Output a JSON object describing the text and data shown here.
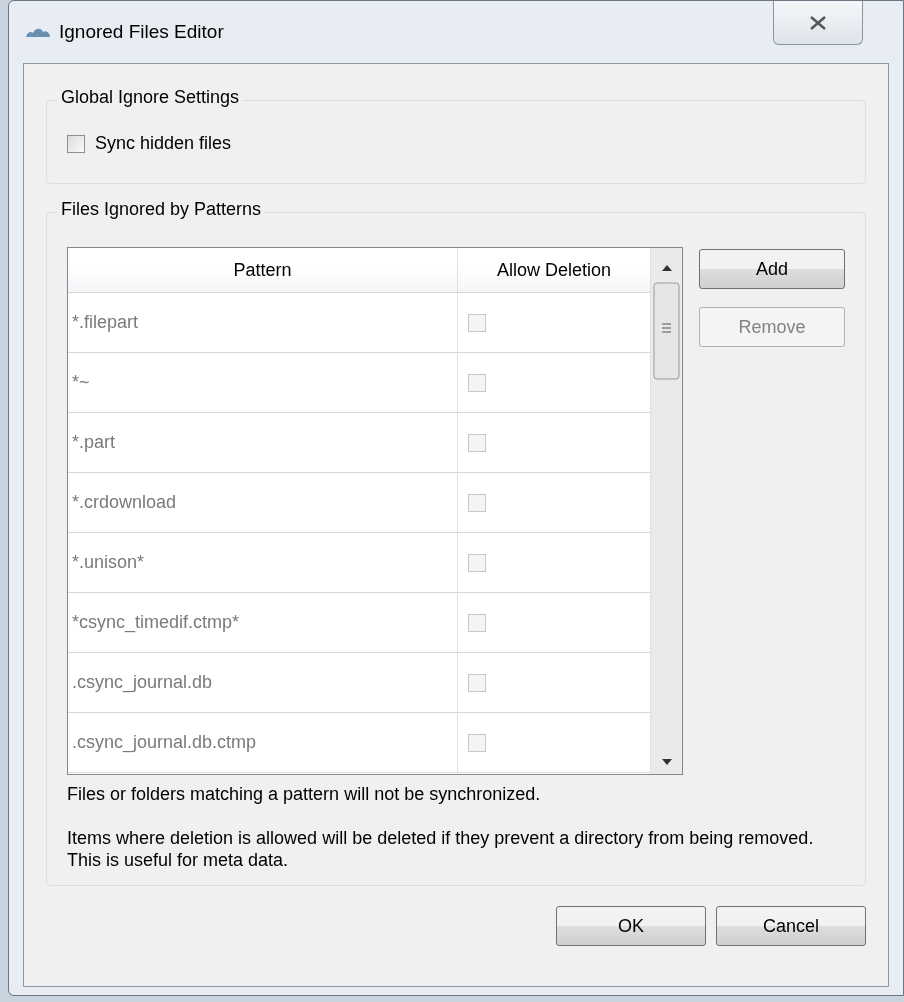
{
  "window": {
    "title": "Ignored Files Editor"
  },
  "global_group": {
    "title": "Global Ignore Settings",
    "checkbox": {
      "label": "Sync hidden files",
      "checked": false
    }
  },
  "patterns_group": {
    "title": "Files Ignored by Patterns",
    "table": {
      "columns": [
        "Pattern",
        "Allow Deletion"
      ],
      "rows": [
        {
          "pattern": "*.filepart",
          "allow_deletion": false,
          "disabled": true
        },
        {
          "pattern": "*~",
          "allow_deletion": false,
          "disabled": true
        },
        {
          "pattern": "*.part",
          "allow_deletion": false,
          "disabled": true
        },
        {
          "pattern": "*.crdownload",
          "allow_deletion": false,
          "disabled": true
        },
        {
          "pattern": "*.unison*",
          "allow_deletion": false,
          "disabled": true
        },
        {
          "pattern": "*csync_timedif.ctmp*",
          "allow_deletion": false,
          "disabled": true
        },
        {
          "pattern": ".csync_journal.db",
          "allow_deletion": false,
          "disabled": true
        },
        {
          "pattern": ".csync_journal.db.ctmp",
          "allow_deletion": false,
          "disabled": true
        }
      ]
    },
    "buttons": [
      {
        "label": "Add",
        "disabled": false
      },
      {
        "label": "Remove",
        "disabled": true
      }
    ],
    "notes": [
      "Files or folders matching a pattern will not be synchronized.",
      "Items where deletion is allowed will be deleted if they prevent a directory from being removed. This is useful for meta data."
    ]
  },
  "dialog_buttons": [
    {
      "label": "OK",
      "disabled": false
    },
    {
      "label": "Cancel",
      "disabled": false
    }
  ]
}
